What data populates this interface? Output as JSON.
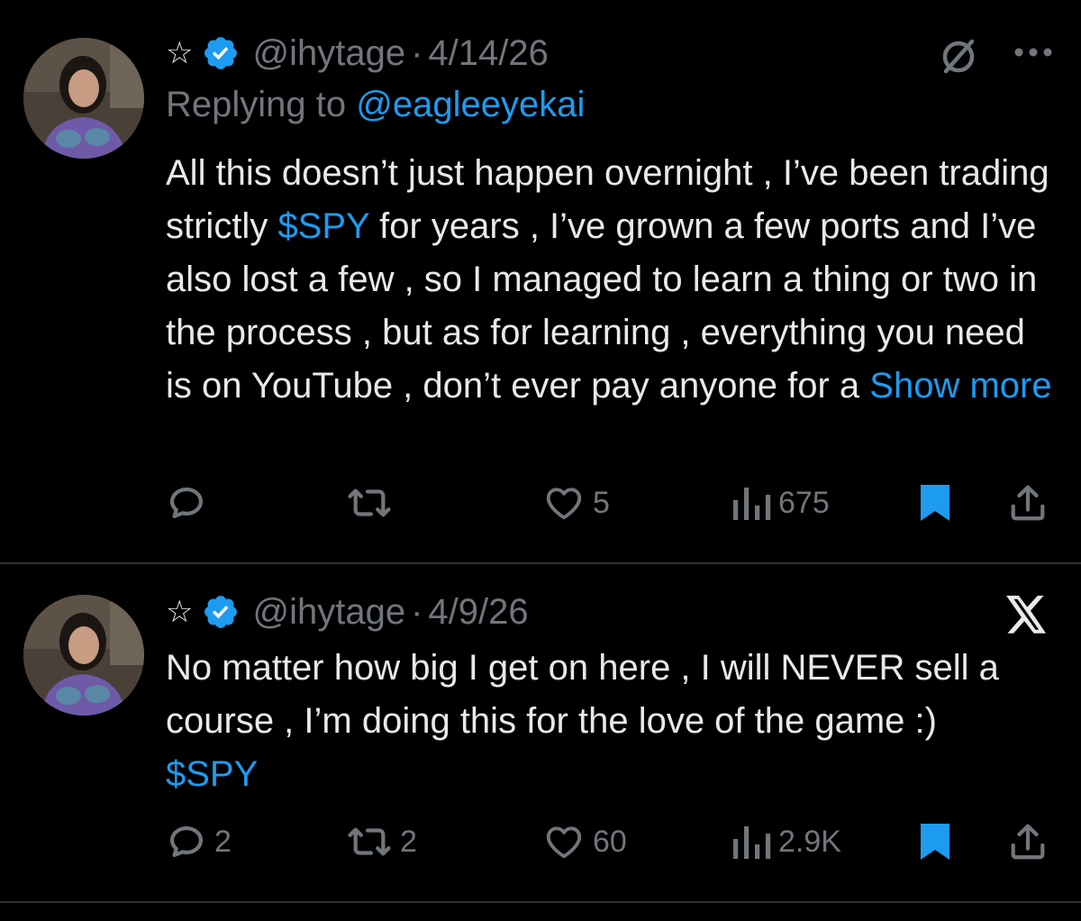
{
  "tweets": [
    {
      "name_symbol": "☆",
      "handle": "@ihytage",
      "separator": "·",
      "date": "4/14/26",
      "replying_prefix": "Replying to",
      "replying_to": "@eagleeyekai",
      "text_before": "All this doesn’t just happen overnight , I’ve been trading strictly ",
      "cashtag": "$SPY",
      "text_after": " for years , I’ve grown a few ports and I’ve also lost a few , so I managed to learn a thing or two in the process , but as for learning , everything you need is on YouTube , don’t ever pay anyone for a ",
      "show_more": "Show more",
      "stats": {
        "replies": "",
        "reposts": "",
        "likes": "5",
        "views": "675"
      },
      "bookmarked": true,
      "top_right_icon": "grok-slash-icon"
    },
    {
      "name_symbol": "☆",
      "handle": "@ihytage",
      "separator": "·",
      "date": "4/9/26",
      "text_line": "No matter how big I get on here , I will NEVER sell a course , I’m doing this for the love of the game :)",
      "cashtag": "$SPY",
      "stats": {
        "replies": "2",
        "reposts": "2",
        "likes": "60",
        "views": "2.9K"
      },
      "bookmarked": true,
      "top_right_icon": "x-logo-icon"
    }
  ],
  "colors": {
    "background": "#000000",
    "text": "#e7e9ea",
    "muted": "#71767b",
    "accent": "#1d9bf0",
    "divider": "#2f3336"
  }
}
